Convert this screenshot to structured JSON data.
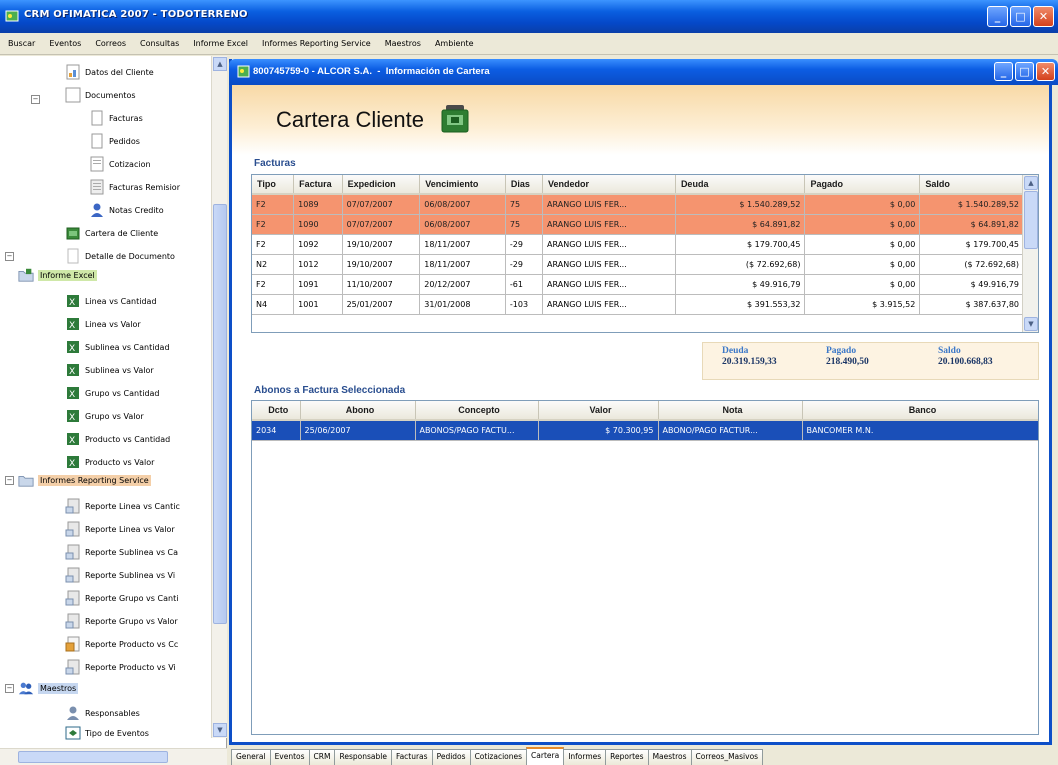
{
  "app": {
    "title": "CRM OFIMATICA 2007 - TODOTERRENO",
    "colors": {
      "titlebar": "#0a5fe0",
      "row_highlight": "#f5946f",
      "selected_row": "#1a4fb8",
      "section_label": "#2a4e8f"
    }
  },
  "menu": [
    "Buscar",
    "Eventos",
    "Correos",
    "Consultas",
    "Informe Excel",
    "Informes Reporting Service",
    "Maestros",
    "Ambiente"
  ],
  "tree": {
    "items": [
      {
        "label": "Datos del Cliente",
        "icon": "document-icon"
      },
      {
        "label": "Documentos",
        "icon": "document-icon"
      },
      {
        "label": "Facturas",
        "icon": "document-icon"
      },
      {
        "label": "Pedidos",
        "icon": "document-icon"
      },
      {
        "label": "Cotizacion",
        "icon": "document-icon"
      },
      {
        "label": "Facturas Remisior",
        "icon": "document-icon"
      },
      {
        "label": "Notas Credito",
        "icon": "person-icon"
      },
      {
        "label": "Cartera de Cliente",
        "icon": "wallet-icon"
      },
      {
        "label": "Detalle de Documento",
        "icon": "document-icon"
      },
      {
        "label": "Informe Excel",
        "icon": "folder-icon"
      },
      {
        "label": "Linea vs Cantidad",
        "icon": "excel-icon"
      },
      {
        "label": "Linea vs Valor",
        "icon": "excel-icon"
      },
      {
        "label": "Sublinea vs Cantidad",
        "icon": "excel-icon"
      },
      {
        "label": "Sublinea vs Valor",
        "icon": "excel-icon"
      },
      {
        "label": "Grupo vs Cantidad",
        "icon": "excel-icon"
      },
      {
        "label": "Grupo vs Valor",
        "icon": "excel-icon"
      },
      {
        "label": "Producto vs Cantidad",
        "icon": "excel-icon"
      },
      {
        "label": "Producto vs Valor",
        "icon": "excel-icon"
      },
      {
        "label": "Informes Reporting Service",
        "icon": "folder-icon"
      },
      {
        "label": "Reporte Linea vs Cantic",
        "icon": "report-icon"
      },
      {
        "label": "Reporte Linea vs Valor",
        "icon": "report-icon"
      },
      {
        "label": "Reporte Sublinea vs Ca",
        "icon": "report-icon"
      },
      {
        "label": "Reporte Sublinea vs Vi",
        "icon": "report-icon"
      },
      {
        "label": "Reporte Grupo vs Canti",
        "icon": "report-icon"
      },
      {
        "label": "Reporte Grupo vs Valor",
        "icon": "report-icon"
      },
      {
        "label": "Reporte Producto vs Cc",
        "icon": "report-icon"
      },
      {
        "label": "Reporte Producto vs Vi",
        "icon": "report-icon"
      },
      {
        "label": "Maestros",
        "icon": "users-icon"
      },
      {
        "label": "Responsables",
        "icon": "person-icon"
      },
      {
        "label": "Tipo de Eventos",
        "icon": "event-icon"
      }
    ]
  },
  "child_window": {
    "title": "800745759-0 - ALCOR S.A.  -  Información de Cartera",
    "banner_title": "Cartera Cliente",
    "facturas_label": "Facturas",
    "facturas": {
      "columns": [
        "Tipo",
        "Factura",
        "Expedicion",
        "Vencimiento",
        "Dias",
        "Vendedor",
        "Deuda",
        "Pagado",
        "Saldo"
      ],
      "rows": [
        [
          "F2",
          "1089",
          "07/07/2007",
          "06/08/2007",
          "75",
          "ARANGO LUIS FER...",
          "$ 1.540.289,52",
          "$ 0,00",
          "$ 1.540.289,52"
        ],
        [
          "F2",
          "1090",
          "07/07/2007",
          "06/08/2007",
          "75",
          "ARANGO LUIS FER...",
          "$ 64.891,82",
          "$ 0,00",
          "$ 64.891,82"
        ],
        [
          "F2",
          "1092",
          "19/10/2007",
          "18/11/2007",
          "-29",
          "ARANGO LUIS FER...",
          "$ 179.700,45",
          "$ 0,00",
          "$ 179.700,45"
        ],
        [
          "N2",
          "1012",
          "19/10/2007",
          "18/11/2007",
          "-29",
          "ARANGO LUIS FER...",
          "($ 72.692,68)",
          "$ 0,00",
          "($ 72.692,68)"
        ],
        [
          "F2",
          "1091",
          "11/10/2007",
          "20/12/2007",
          "-61",
          "ARANGO LUIS FER...",
          "$ 49.916,79",
          "$ 0,00",
          "$ 49.916,79"
        ],
        [
          "N4",
          "1001",
          "25/01/2007",
          "31/01/2008",
          "-103",
          "ARANGO LUIS FER...",
          "$ 391.553,32",
          "$ 3.915,52",
          "$ 387.637,80"
        ]
      ],
      "highlighted_rows": 2
    },
    "totals": {
      "deuda_label": "Deuda",
      "deuda_value": "20.319.159,33",
      "pagado_label": "Pagado",
      "pagado_value": "218.490,50",
      "saldo_label": "Saldo",
      "saldo_value": "20.100.668,83"
    },
    "abonos_label": "Abonos a Factura Seleccionada",
    "abonos": {
      "columns": [
        "Dcto",
        "Abono",
        "Concepto",
        "Valor",
        "Nota",
        "Banco"
      ],
      "rows": [
        [
          "2034",
          "25/06/2007",
          "ABONOS/PAGO FACTU...",
          "$ 70.300,95",
          "ABONO/PAGO FACTUR...",
          "BANCOMER M.N."
        ]
      ]
    }
  },
  "tabs": [
    "General",
    "Eventos",
    "CRM",
    "Responsable",
    "Facturas",
    "Pedidos",
    "Cotizaciones",
    "Cartera",
    "Informes",
    "Reportes",
    "Maestros",
    "Correos_Masivos"
  ],
  "active_tab": "Cartera"
}
